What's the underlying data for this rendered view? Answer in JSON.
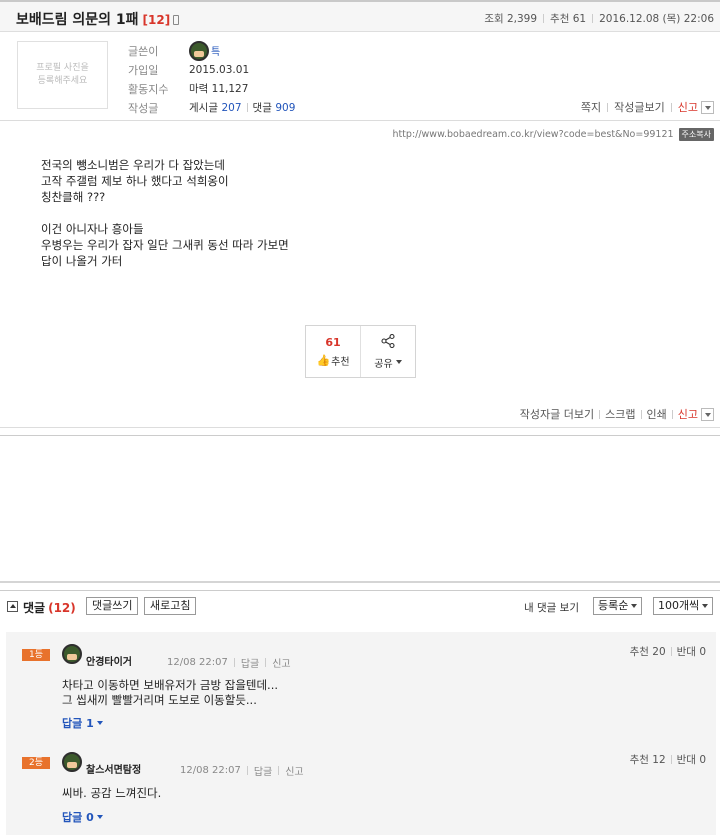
{
  "post": {
    "title": "보배드림 의문의 1패",
    "comment_count": "[12]",
    "views_label": "조회",
    "views": "2,399",
    "recommend_label": "추천",
    "recommend": "61",
    "datetime": "2016.12.08 (목) 22:06"
  },
  "profile": {
    "photo_text_1": "프로필 사진을",
    "photo_text_2": "등록해주세요",
    "author_label": "글쓴이",
    "author_nick": "특",
    "joined_label": "가입일",
    "joined": "2015.03.01",
    "activity_label": "활동지수",
    "activity": "마력 11,127",
    "posts_label": "작성글",
    "posts_prefix": "게시글",
    "posts_count": "207",
    "comments_prefix": "댓글",
    "comments_count": "909",
    "actions": {
      "message": "쪽지",
      "view_posts": "작성글보기",
      "report": "신고"
    }
  },
  "url": {
    "text": "http://www.bobaedream.co.kr/view?code=best&No=99121",
    "copy": "주소복사"
  },
  "body": {
    "lines": [
      "전국의 뺑소니범은 우리가 다 잡았는데",
      "고작 주갤럼 제보 하나 했다고 석희옹이",
      "칭찬클해 ???",
      "",
      "이건 아니자나 흥아들",
      "우병우는 우리가 잡자 일단 그새퀴 동선 따라 가보면",
      "답이 나올거 가터"
    ]
  },
  "actions": {
    "recommend_count": "61",
    "recommend_label": "추천",
    "share_label": "공유",
    "more_posts": "작성자글 더보기",
    "scrap": "스크랩",
    "print": "인쇄",
    "report": "신고"
  },
  "comments_header": {
    "title": "댓글",
    "count": "(12)",
    "write": "댓글쓰기",
    "refresh": "새로고침",
    "my_comments": "내 댓글 보기",
    "sort": "등록순",
    "per_page": "100개씩"
  },
  "comments": [
    {
      "badge": "1등",
      "nick": "안경타이거",
      "time": "12/08 22:07",
      "reply": "답글",
      "report": "신고",
      "up_label": "추천",
      "up": "20",
      "down_label": "반대",
      "down": "0",
      "lines": [
        "차타고 이동하면 보배유저가 금방 잡을텐데...",
        "그 씹새끼 빨빨거리며 도보로 이동할듯..."
      ],
      "replies_label": "답글",
      "replies": "1"
    },
    {
      "badge": "2등",
      "nick": "찰스서면탐정",
      "time": "12/08 22:07",
      "reply": "답글",
      "report": "신고",
      "up_label": "추천",
      "up": "12",
      "down_label": "반대",
      "down": "0",
      "lines": [
        "씨바. 공감 느껴진다."
      ],
      "replies_label": "답글",
      "replies": "0"
    }
  ],
  "colors": {
    "accent": "#d8352a",
    "link": "#2255bb",
    "badge": "#e8722c"
  }
}
